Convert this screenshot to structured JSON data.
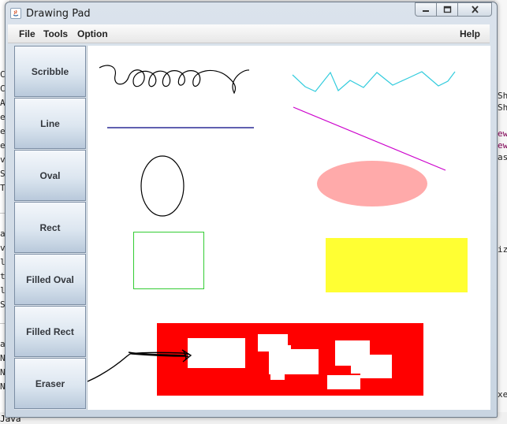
{
  "window": {
    "title": "Drawing Pad",
    "controls": [
      "minimize",
      "maximize",
      "close"
    ]
  },
  "menubar": {
    "items": [
      "File",
      "Tools",
      "Option"
    ],
    "help": "Help"
  },
  "tools": {
    "buttons": [
      "Scribble",
      "Line",
      "Oval",
      "Rect",
      "Filled Oval",
      "Filled Rect",
      "Eraser"
    ]
  },
  "canvas": {
    "shapes": [
      {
        "kind": "scribble",
        "color": "#000000"
      },
      {
        "kind": "scribble",
        "color": "#33ccdd"
      },
      {
        "kind": "line",
        "color": "#000080"
      },
      {
        "kind": "line",
        "color": "#cc00cc"
      },
      {
        "kind": "oval",
        "color": "#000000"
      },
      {
        "kind": "filled-oval",
        "color": "#ffaaaa"
      },
      {
        "kind": "rect",
        "color": "#33cc33"
      },
      {
        "kind": "filled-rect",
        "color": "#ffff33"
      },
      {
        "kind": "filled-rect",
        "color": "#ff0000"
      },
      {
        "kind": "eraser-marks",
        "color": "#ffffff"
      },
      {
        "kind": "scribble",
        "color": "#000000"
      }
    ]
  },
  "background": {
    "left_fragments": [
      "Ca",
      "Ca",
      "Ac",
      "ej",
      "e.",
      "eS",
      "va",
      "Sh",
      "To",
      "ac",
      "va",
      "lS",
      "ta",
      "le",
      "Sh",
      "ac",
      "ND",
      "ND",
      "NT",
      "Java"
    ],
    "right_fragments": [
      "Sh",
      "Sh",
      "ew",
      "ew",
      "as",
      "iz",
      "xe"
    ]
  },
  "colors": {
    "canvas_bg": "#ffffff",
    "window_frame": "#c9d5e2",
    "button_text": "#33373d"
  }
}
